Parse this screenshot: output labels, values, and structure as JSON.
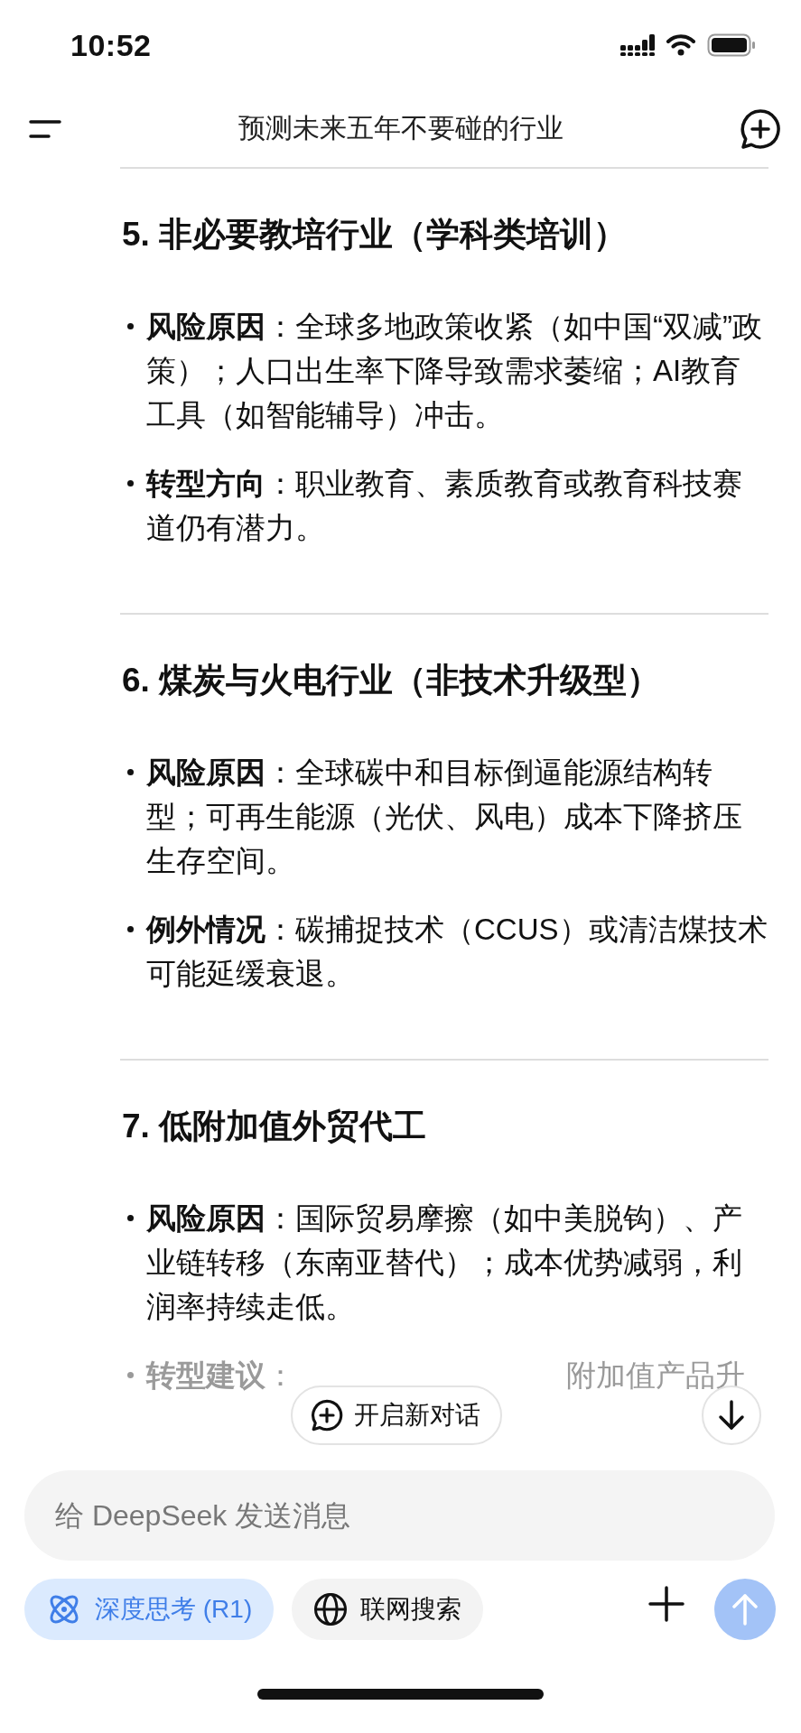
{
  "status_bar": {
    "time": "10:52"
  },
  "nav": {
    "title": "预测未来五年不要碰的行业"
  },
  "sections": [
    {
      "heading": "5. 非必要教培行业（学科类培训）",
      "bullets": [
        {
          "kind": "full",
          "text": "**风险原因**：全球多地政策收紧（如中国“双减”政策）；人口出生率下降导致需求萎缩；AI教育工具（如智能辅导）冲击。"
        },
        {
          "kind": "full",
          "text": "**转型方向**：职业教育、素质教育或教育科技赛道仍有潜力。"
        }
      ]
    },
    {
      "heading": "6. 煤炭与火电行业（非技术升级型）",
      "bullets": [
        {
          "kind": "full",
          "text": "**风险原因**：全球碳中和目标倒逼能源结构转型；可再生能源（光伏、风电）成本下降挤压生存空间。"
        },
        {
          "kind": "full",
          "text": "**例外情况**：碳捕捉技术（CCUS）或清洁煤技术可能延缓衰退。"
        }
      ]
    },
    {
      "heading": "7. 低附加值外贸代工",
      "bullets": [
        {
          "kind": "full",
          "text": "**风险原因**：国际贸易摩擦（如中美脱钩）、产业链转移（东南亚替代）；成本优势减弱，利润率持续走低。"
        },
        {
          "kind": "partial",
          "text": "**转型建议**：",
          "tail": "附加值产品升"
        }
      ]
    }
  ],
  "new_chat_button": {
    "label": "开启新对话"
  },
  "composer": {
    "placeholder": "给 DeepSeek 发送消息",
    "chips": [
      {
        "kind": "think",
        "label": "深度思考 (R1)",
        "selected": true
      },
      {
        "kind": "search",
        "label": "联网搜索",
        "selected": false
      }
    ],
    "send_disabled": true
  }
}
